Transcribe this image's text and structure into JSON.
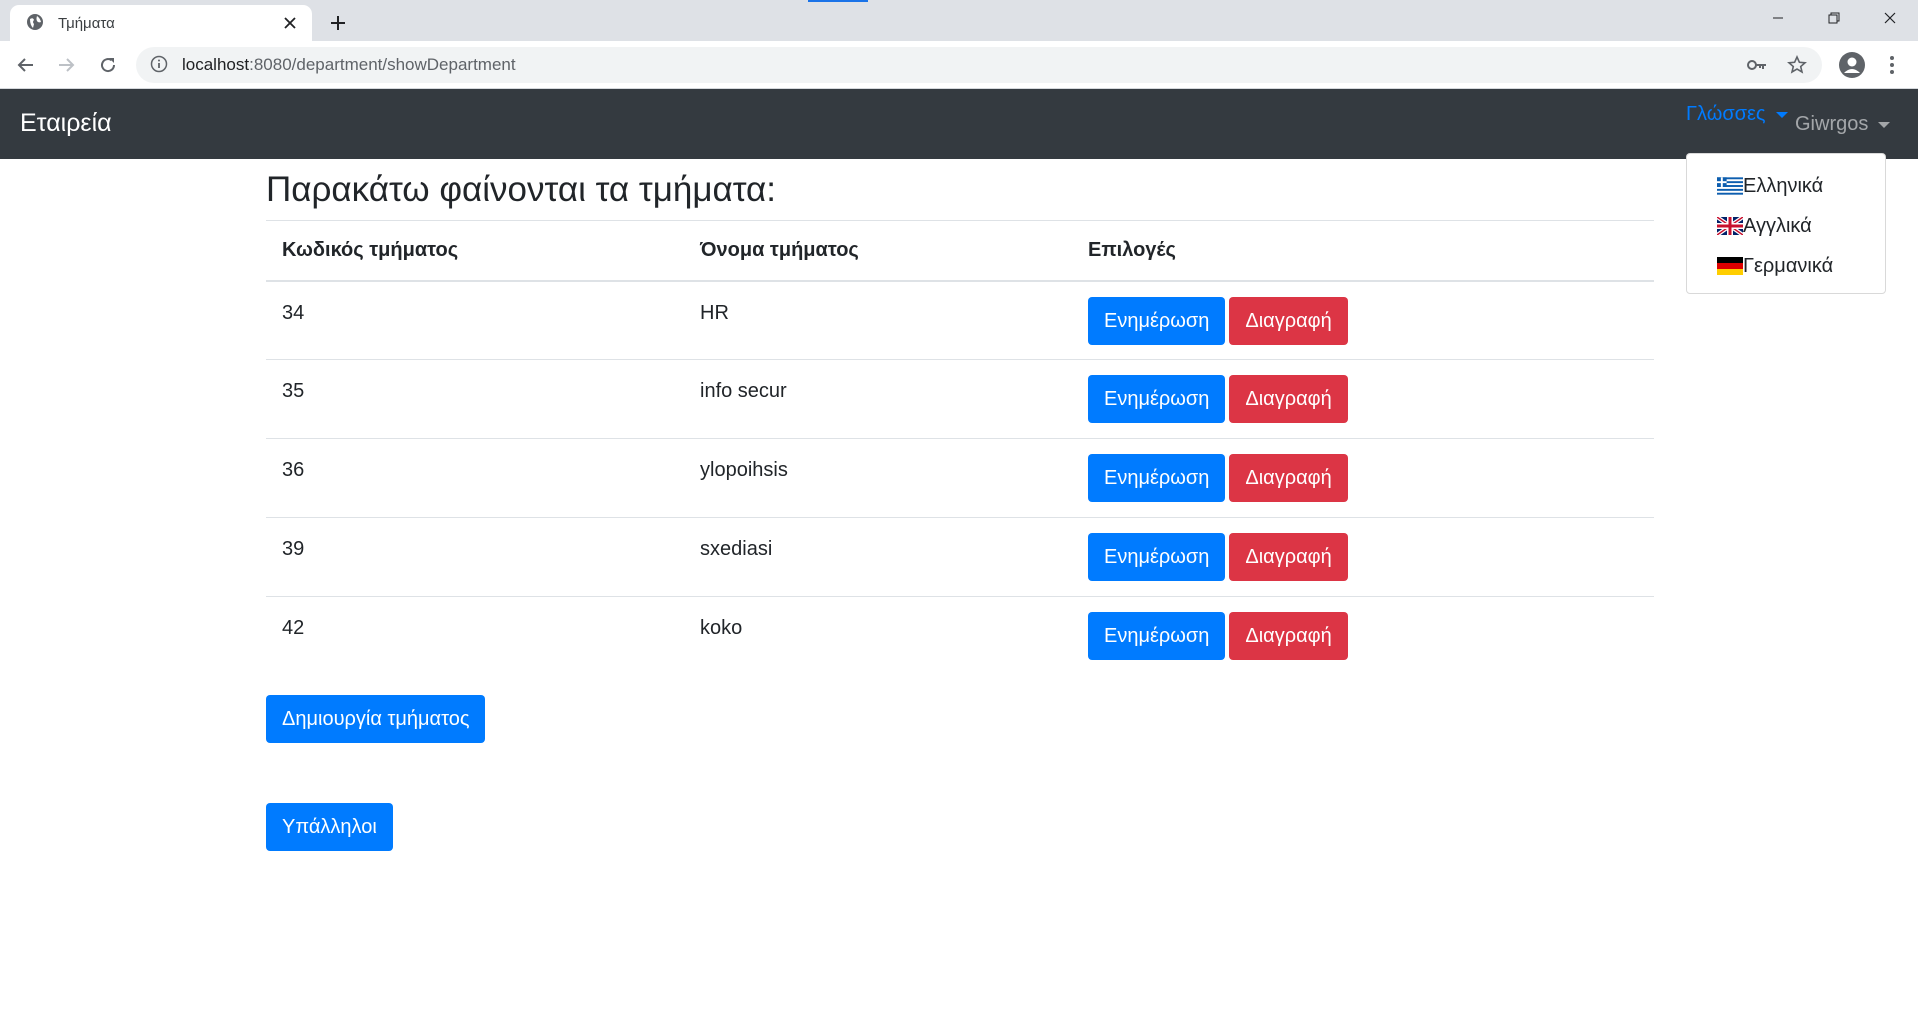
{
  "browser": {
    "tab_title": "Τμήματα",
    "url_host": "localhost",
    "url_rest": ":8080/department/showDepartment"
  },
  "navbar": {
    "brand": "Εταιρεία",
    "languages_label": "Γλώσσες",
    "user_label": "Giwrgos"
  },
  "language_menu": [
    {
      "label": "Ελληνικά",
      "flag": "greece-flag"
    },
    {
      "label": "Αγγλικά",
      "flag": "uk-flag"
    },
    {
      "label": "Γερμανικά",
      "flag": "germany-flag"
    }
  ],
  "heading": "Παρακάτω φαίνονται τα τμήματα:",
  "table": {
    "headers": [
      "Κωδικός τμήματος",
      "Όνομα τμήματος",
      "Επιλογές"
    ],
    "rows": [
      {
        "code": "34",
        "name": "HR"
      },
      {
        "code": "35",
        "name": "info secur"
      },
      {
        "code": "36",
        "name": "ylopoihsis"
      },
      {
        "code": "39",
        "name": "sxediasi"
      },
      {
        "code": "42",
        "name": "koko"
      }
    ],
    "update_label": "Ενημέρωση",
    "delete_label": "Διαγραφή"
  },
  "buttons": {
    "create": "Δημιουργία τμήματος",
    "employees": "Υπάλληλοι"
  },
  "colors": {
    "primary": "#007bff",
    "danger": "#dc3545",
    "navbar": "#343a40"
  }
}
